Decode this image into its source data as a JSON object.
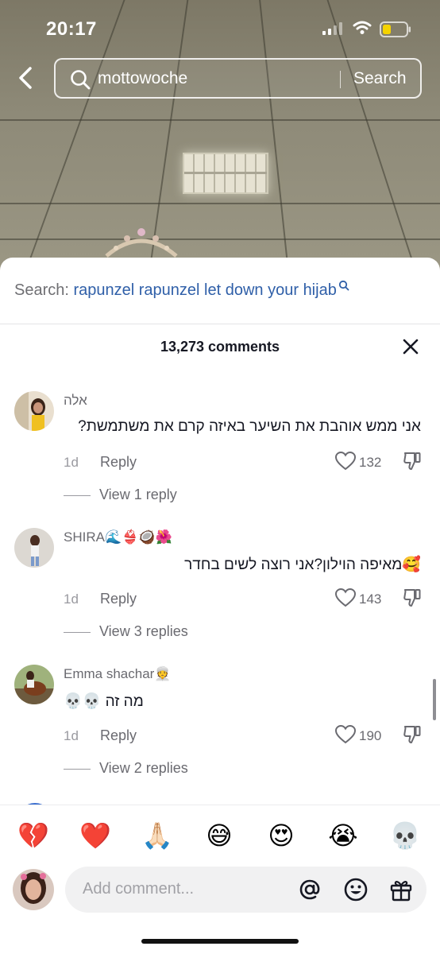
{
  "status_bar": {
    "time": "20:17",
    "battery_color": "#f5d300"
  },
  "search": {
    "query": "mottowoche",
    "button_label": "Search"
  },
  "related_search": {
    "label": "Search:",
    "term": "rapunzel rapunzel let down your hijab"
  },
  "comments_header": {
    "count_label": "13,273 comments"
  },
  "comments": [
    {
      "username": "אלה",
      "text": "אני ממש אוהבת את השיער באיזה קרם את משתמשת?",
      "time": "1d",
      "reply_label": "Reply",
      "likes": "132",
      "view_replies": "View 1 reply"
    },
    {
      "username": "SHIRA🌊👙🥥🌺",
      "text": "🥰מאיפה הוילון?אני רוצה לשים בחדר",
      "time": "1d",
      "reply_label": "Reply",
      "likes": "143",
      "view_replies": "View 3 replies"
    },
    {
      "username": "Emma shachar👳",
      "text": "💀💀 מה זה",
      "time": "1d",
      "reply_label": "Reply",
      "likes": "190",
      "view_replies": "View 2 replies"
    }
  ],
  "quick_emojis": [
    "💔",
    "❤️",
    "🙏🏻",
    "😅",
    "😍",
    "😭",
    "💀"
  ],
  "comment_input": {
    "placeholder": "Add comment..."
  },
  "icons": [
    "back-icon",
    "search-icon",
    "close-icon",
    "heart-icon",
    "dislike-icon",
    "mention-icon",
    "emoji-icon",
    "gift-icon"
  ]
}
